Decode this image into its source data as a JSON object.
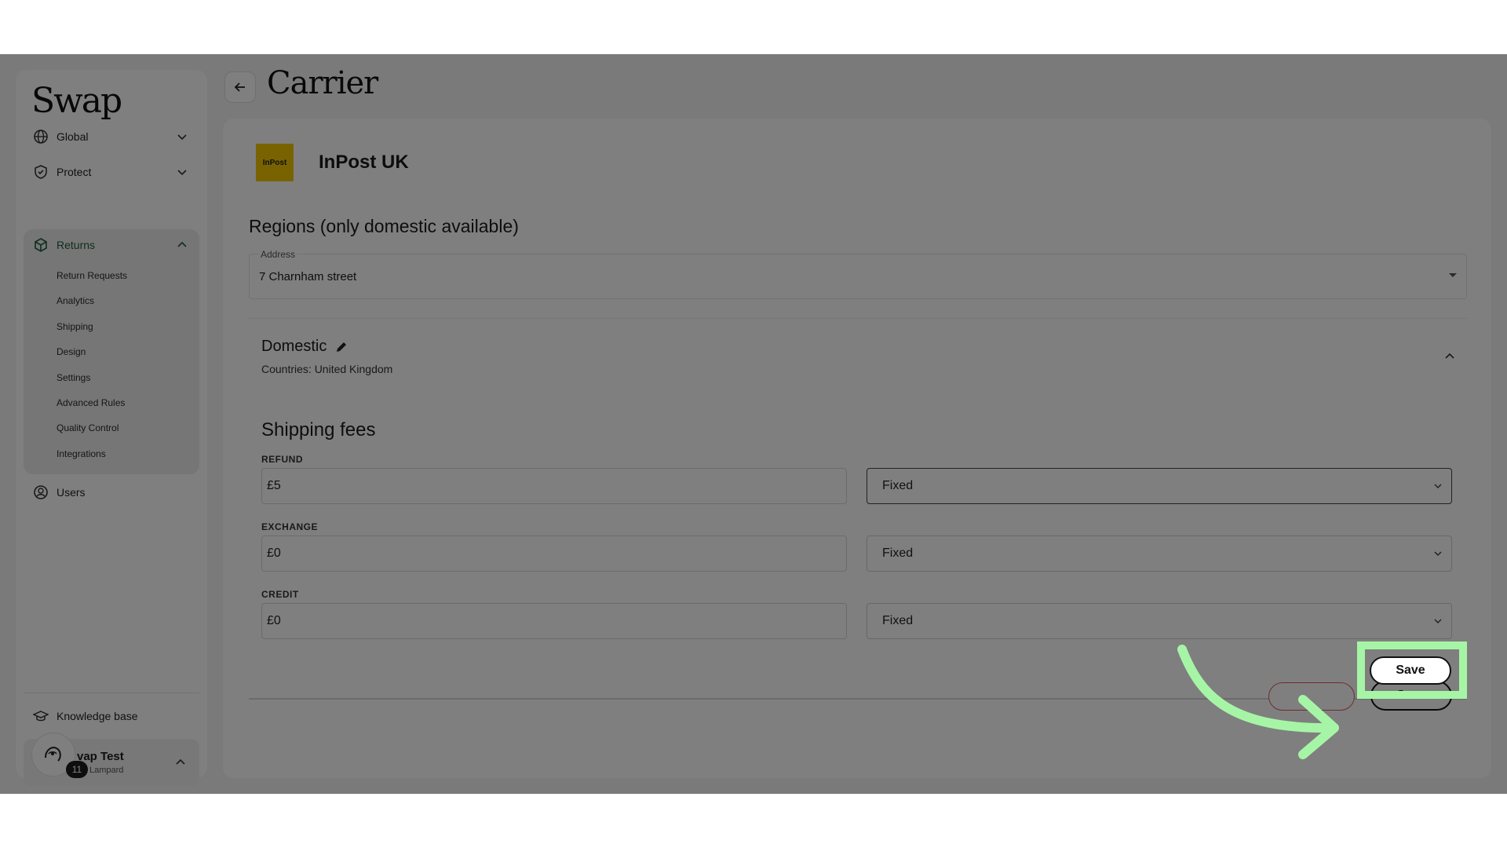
{
  "app": {
    "logo": "Swap"
  },
  "sidebar": {
    "items": [
      {
        "label": "Global",
        "icon": "globe-icon"
      },
      {
        "label": "Protect",
        "icon": "shield-icon"
      },
      {
        "label": "Returns",
        "icon": "box-icon"
      },
      {
        "label": "Users",
        "icon": "user-circle-icon"
      }
    ],
    "returns_sub": [
      "Return Requests",
      "Analytics",
      "Shipping",
      "Design",
      "Settings",
      "Advanced Rules",
      "Quality Control",
      "Integrations"
    ],
    "knowledge_base": "Knowledge base",
    "user": {
      "name": "vap Test",
      "sub": "Lampard",
      "badge": "11"
    }
  },
  "header": {
    "title": "Carrier"
  },
  "carrier": {
    "logo_text": "InPost",
    "name": "InPost UK"
  },
  "regions": {
    "title": "Regions (only domestic available)",
    "address_label": "Address",
    "address_value": "7 Charnham street",
    "region_name": "Domestic",
    "countries": "Countries: United Kingdom"
  },
  "shipping_fees": {
    "title": "Shipping fees",
    "rows": [
      {
        "label": "REFUND",
        "amount": "£5",
        "type": "Fixed"
      },
      {
        "label": "EXCHANGE",
        "amount": "£0",
        "type": "Fixed"
      },
      {
        "label": "CREDIT",
        "amount": "£0",
        "type": "Fixed"
      }
    ]
  },
  "actions": {
    "save_label": "Save"
  },
  "overlay": {
    "highlight_color": "#a6f5a6",
    "arrow_color": "#a6f5a6"
  }
}
